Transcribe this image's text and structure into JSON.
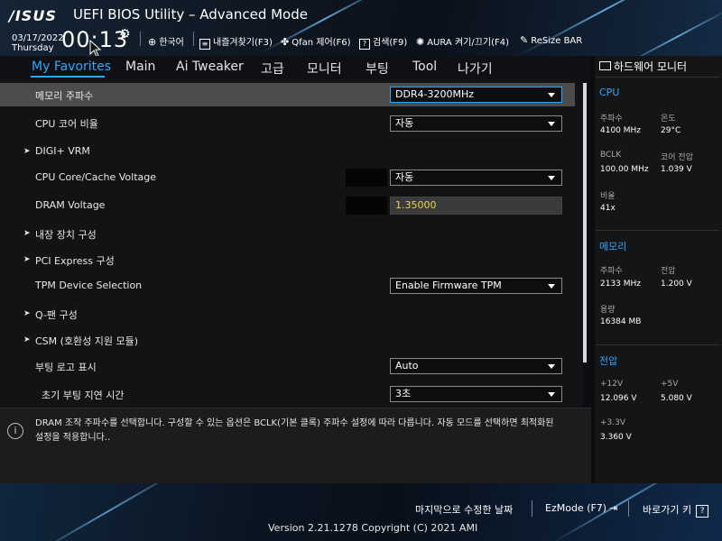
{
  "header": {
    "logo": "/ISUS",
    "title": "UEFI BIOS Utility – Advanced Mode",
    "date": "03/17/2022",
    "day": "Thursday",
    "time": "00:13",
    "tools": [
      {
        "label": "한국어",
        "icon": "globe-icon"
      },
      {
        "label": "내즐겨찾기(F3)",
        "icon": "favorites-icon"
      },
      {
        "label": "Qfan 제어(F6)",
        "icon": "fan-icon"
      },
      {
        "label": "검색(F9)",
        "icon": "search-help-icon"
      },
      {
        "label": "AURA 켜기/끄기(F4)",
        "icon": "aura-icon"
      },
      {
        "label": "ReSize BAR",
        "icon": "resize-bar-icon"
      }
    ]
  },
  "menu": {
    "tabs": [
      "My Favorites",
      "Main",
      "Ai Tweaker",
      "고급",
      "모니터",
      "부팅",
      "Tool",
      "나가기"
    ],
    "active": "My Favorites"
  },
  "settings": [
    {
      "label": "메모리 주파수",
      "value": "DDR4-3200MHz"
    },
    {
      "label": "CPU 코어 비율",
      "value": "자동"
    },
    {
      "label": "DIGI+ VRM"
    },
    {
      "label": "CPU Core/Cache Voltage",
      "value": "자동"
    },
    {
      "label": "DRAM Voltage",
      "value": "1.35000"
    },
    {
      "label": "내장 장치 구성"
    },
    {
      "label": "PCI Express 구성"
    },
    {
      "label": "TPM Device Selection",
      "value": "Enable Firmware TPM"
    },
    {
      "label": "Q-팬 구성"
    },
    {
      "label": "CSM (호환성 지원 모듈)"
    },
    {
      "label": "부팅 로고 표시",
      "value": "Auto"
    },
    {
      "label": "초기 부팅 지연 시간",
      "value": "3초"
    }
  ],
  "help": {
    "line1": "DRAM 조작 주파수를 선택합니다. 구성할 수 있는 옵션은 BCLK(기본 클록) 주파수 설정에 따라 다릅니다. 자동 모드를 선택하면 최적화된",
    "line2": "설정을 적용합니다.."
  },
  "hw_monitor": {
    "title": "하드웨어 모니터",
    "cpu": {
      "section": "CPU",
      "freq_label": "주파수",
      "freq": "4100 MHz",
      "temp_label": "온도",
      "temp": "29°C",
      "bclk_label": "BCLK",
      "bclk": "100.00 MHz",
      "vcore_label": "코어 전압",
      "vcore": "1.039 V",
      "ratio_label": "비율",
      "ratio": "41x"
    },
    "memory": {
      "section": "메모리",
      "freq_label": "주파수",
      "freq": "2133 MHz",
      "volt_label": "전압",
      "volt": "1.200 V",
      "cap_label": "용량",
      "cap": "16384 MB"
    },
    "voltage": {
      "section": "전압",
      "v12_label": "+12V",
      "v12": "12.096 V",
      "v5_label": "+5V",
      "v5": "5.080 V",
      "v33_label": "+3.3V",
      "v33": "3.360 V"
    }
  },
  "footer": {
    "last_modified": "마지막으로 수정한 날짜",
    "ezmode": "EzMode (F7)",
    "hotkeys": "바로가기 키",
    "hotkey_symbol": "?",
    "version": "Version 2.21.1278 Copyright (C) 2021 AMI"
  },
  "colors": {
    "accent": "#2ea7ff",
    "dram_value": "#f2d24a",
    "selected_row": "#4b4c4e"
  }
}
